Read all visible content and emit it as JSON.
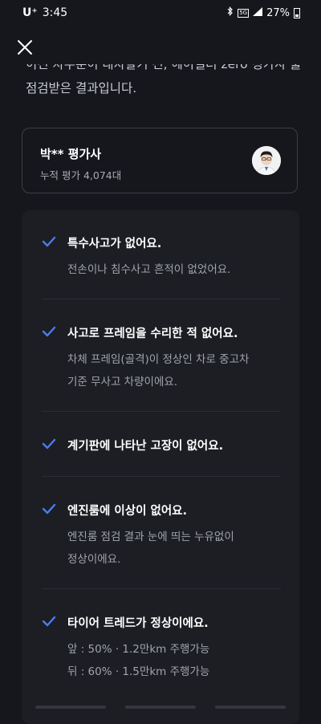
{
  "status_bar": {
    "carrier": "U⁺",
    "time": "3:45",
    "network": "5G",
    "battery": "27%"
  },
  "header": {
    "close_icon": "close-icon"
  },
  "intro": {
    "line1": "이전 차주분이 내차팔기 전, 헤이딜러 zero 평가사 출장",
    "line2": "점검받은 결과입니다."
  },
  "evaluator": {
    "name": "박** 평가사",
    "count": "누적 평가 4,074대"
  },
  "checks": [
    {
      "title": "특수사고가 없어요.",
      "desc": [
        "전손이나 침수사고 흔적이 없었어요."
      ]
    },
    {
      "title": "사고로 프레임을 수리한 적 없어요.",
      "desc": [
        "차체 프레임(골격)이 정상인 차로 중고차",
        "기준 무사고 차량이에요."
      ]
    },
    {
      "title": "계기판에 나타난 고장이 없어요.",
      "desc": []
    },
    {
      "title": "엔진룸에 이상이 없어요.",
      "desc": [
        "엔진룸 점검 결과 눈에 띄는 누유없이",
        "정상이에요."
      ]
    },
    {
      "title": "타이어 트레드가 정상이에요.",
      "desc": [
        "앞 : 50% · 1.2만km 주행가능",
        "뒤 : 60% · 1.5만km 주행가능"
      ]
    }
  ],
  "colors": {
    "background": "#15171c",
    "card": "#1c1e24",
    "check": "#4a7cf0"
  }
}
